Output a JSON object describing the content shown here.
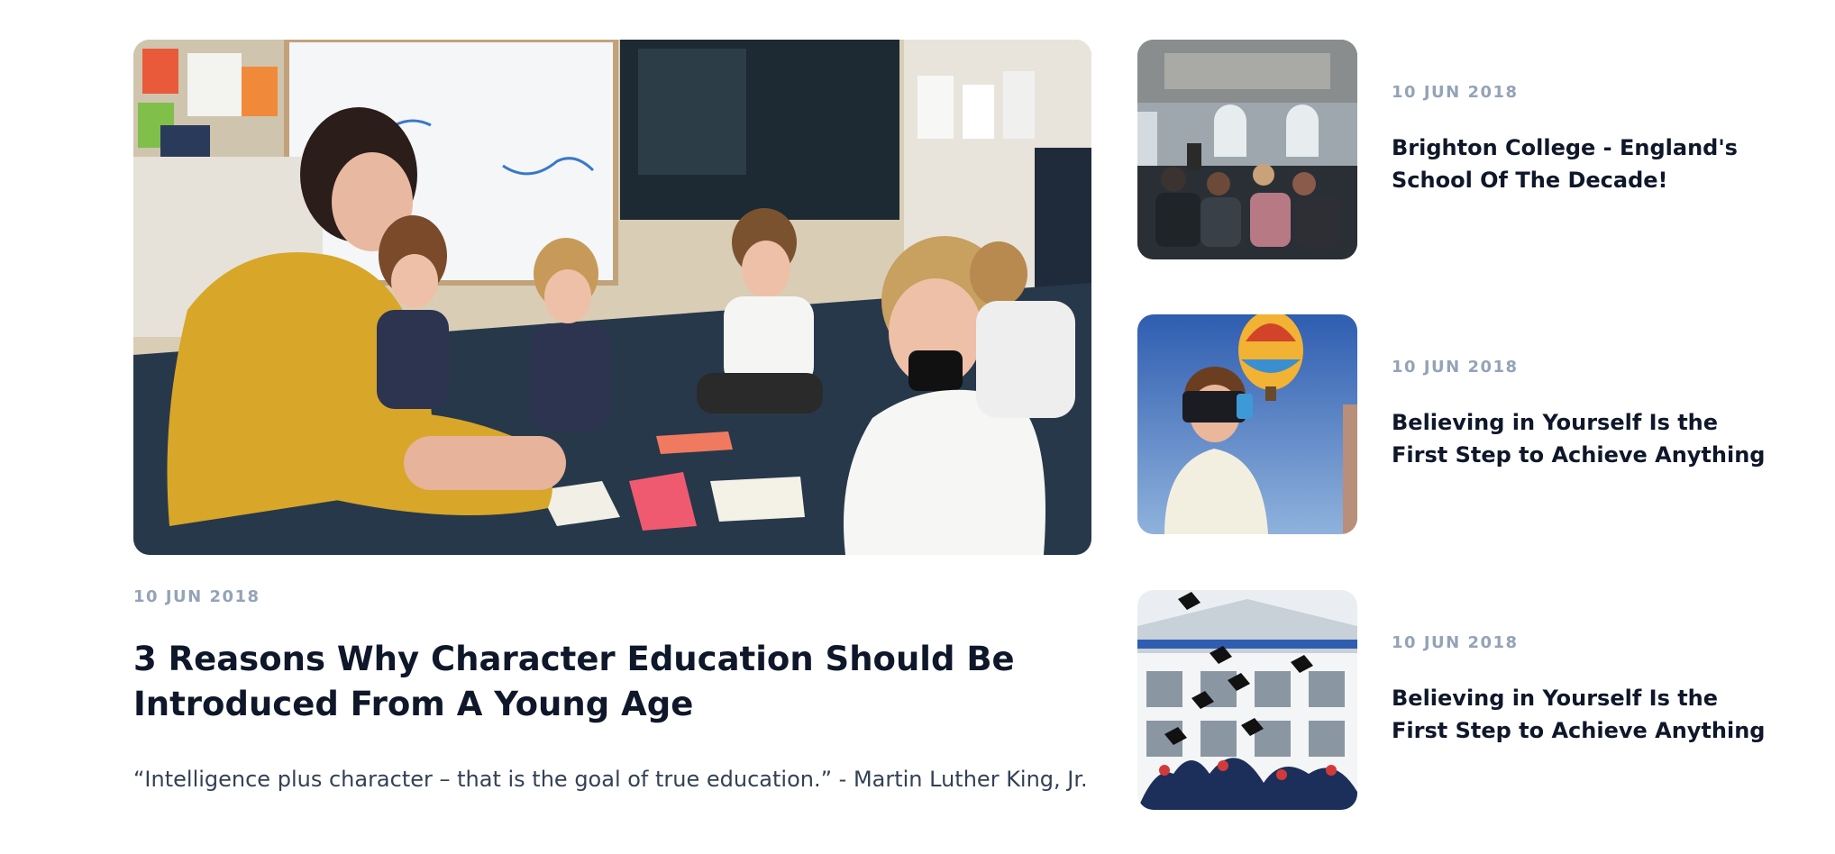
{
  "featured": {
    "image_alt": "Teacher sitting on the floor with young students in a classroom",
    "date": "10 JUN 2018",
    "title": "3 Reasons Why Character Education Should Be Introduced From A Young Age",
    "excerpt": "“Intelligence plus character – that is the goal of true education.” - Martin Luther King, Jr."
  },
  "side_posts": [
    {
      "image_alt": "Audience seated in a hall listening to a speaker",
      "date": "10 JUN 2018",
      "title": "Brighton College - England's School Of The Decade!"
    },
    {
      "image_alt": "Boy wearing a VR headset with hot air balloon in background",
      "date": "10 JUN 2018",
      "title": "Believing in Yourself Is the First Step to Achieve Anything"
    },
    {
      "image_alt": "Graduates throwing caps in the air in front of a building",
      "date": "10 JUN 2018",
      "title": "Believing in Yourself Is the First Step to Achieve Anything"
    }
  ],
  "colors": {
    "title": "#0f172a",
    "date": "#94a3b8",
    "excerpt": "#334155",
    "background": "#ffffff"
  }
}
